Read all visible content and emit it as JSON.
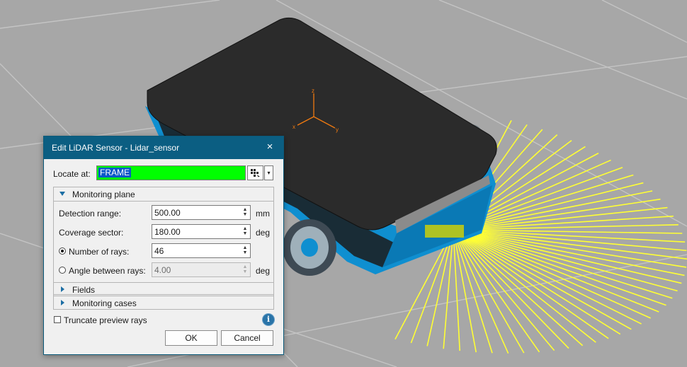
{
  "dialog": {
    "title": "Edit LiDAR Sensor - Lidar_sensor",
    "close_glyph": "×",
    "locate": {
      "label": "Locate at:",
      "value": "FRAME",
      "picker_icon": "frame-picker-icon",
      "dropdown_glyph": "▾"
    },
    "monitoring_plane": {
      "title": "Monitoring plane",
      "detection_range": {
        "label": "Detection range:",
        "value": "500.00",
        "unit": "mm"
      },
      "coverage_sector": {
        "label": "Coverage sector:",
        "value": "180.00",
        "unit": "deg"
      },
      "number_of_rays": {
        "label": "Number of rays:",
        "value": "46",
        "selected": true
      },
      "angle_between_rays": {
        "label": "Angle between rays:",
        "value": "4.00",
        "unit": "deg",
        "selected": false
      }
    },
    "fields": {
      "title": "Fields"
    },
    "monitoring_cases": {
      "title": "Monitoring cases"
    },
    "truncate": {
      "label": "Truncate preview rays",
      "checked": false
    },
    "info_glyph": "i",
    "ok_label": "OK",
    "cancel_label": "Cancel"
  },
  "viewport": {
    "axes": {
      "z": "z",
      "x": "x",
      "y": "y"
    },
    "colors": {
      "background": "#a7a7a7",
      "robot_top": "#2b2b2b",
      "robot_body": "#0f8fd0",
      "rays": "#ffff33",
      "axes": "#f07a10",
      "title_bar": "#0b5e82",
      "locate_highlight": "#00ff00"
    }
  }
}
